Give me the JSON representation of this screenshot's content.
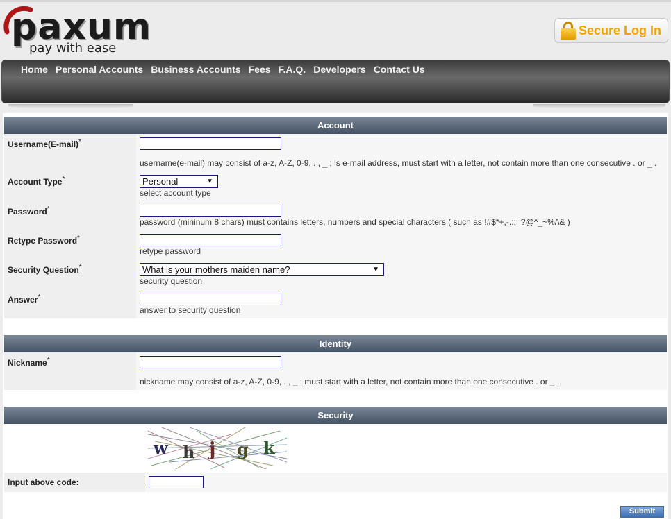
{
  "brand": {
    "logo_text": "paxum",
    "tagline": "pay with ease"
  },
  "header": {
    "secure_login": "Secure Log In"
  },
  "nav": [
    "Home",
    "Personal Accounts",
    "Business Accounts",
    "Fees",
    "F.A.Q.",
    "Developers",
    "Contact Us"
  ],
  "sections": {
    "account": "Account",
    "identity": "Identity",
    "security": "Security"
  },
  "fields": {
    "username": {
      "label": "Username(E-mail)",
      "required": "*",
      "value": "",
      "hint": "username(e-mail) may consist of a-z, A-Z, 0-9, . , _ ; is e-mail address, must start with a letter, not contain more than one consecutive . or _ ."
    },
    "account_type": {
      "label": "Account Type",
      "required": "*",
      "selected": "Personal",
      "hint": "select account type"
    },
    "password": {
      "label": "Password",
      "required": "*",
      "value": "",
      "hint": "password (mininum 8 chars) must contains letters, numbers and special characters ( such as !#$*+,-.:;=?@^_~%/\\& )"
    },
    "retype_password": {
      "label": "Retype Password",
      "required": "*",
      "value": "",
      "hint": "retype password"
    },
    "security_question": {
      "label": "Security Question",
      "required": "*",
      "selected": "What is your mothers maiden name?",
      "hint": "security question"
    },
    "answer": {
      "label": "Answer",
      "required": "*",
      "value": "",
      "hint": "answer to security question"
    },
    "nickname": {
      "label": "Nickname",
      "required": "*",
      "value": "",
      "hint": "nickname may consist of a-z, A-Z, 0-9, . , _ ; must start with a letter, not contain more than one consecutive . or _ ."
    },
    "captcha_code": {
      "label": "Input above code:",
      "value": ""
    }
  },
  "captcha": {
    "text": "whjgk"
  },
  "submit_label": "Submit",
  "colors": {
    "nav_bg": "#4a4a4a",
    "section_header": "#5c6a7c",
    "secure_login": "#f0a400",
    "input_border": "#1a1a80",
    "submit": "#3e6fb2"
  }
}
